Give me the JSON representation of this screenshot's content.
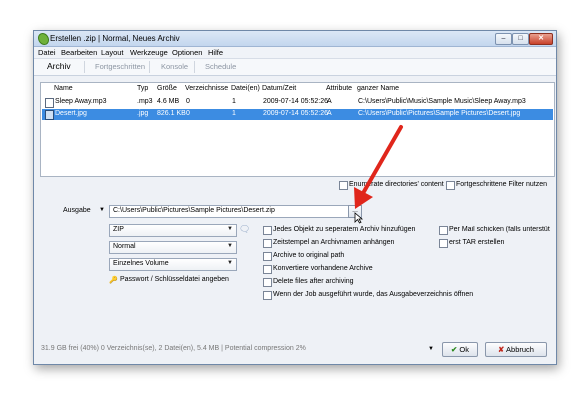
{
  "window": {
    "title": "Erstellen .zip | Normal, Neues Archiv",
    "controls": [
      "minimize",
      "maximize",
      "close"
    ]
  },
  "menu": [
    "Datei",
    "Bearbeiten",
    "Layout",
    "Werkzeuge",
    "Optionen",
    "Hilfe"
  ],
  "tabs": [
    "Archiv",
    "Fortgeschritten",
    "Konsole",
    "Schedule"
  ],
  "files": {
    "columns": [
      "Name",
      "Typ",
      "Größe",
      "Verzeichnisse",
      "Datei(en)",
      "Datum/Zeit",
      "Attribute",
      "ganzer Name"
    ],
    "rows": [
      [
        "Sleep Away.mp3",
        ".mp3",
        "4.6 MB",
        "0",
        "1",
        "2009-07-14 05:52:26",
        "A",
        "C:\\Users\\Public\\Music\\Sample Music\\Sleep Away.mp3"
      ],
      [
        "Desert.jpg",
        ".jpg",
        "826.1 KB",
        "0",
        "1",
        "2009-07-14 05:52:26",
        "A",
        "C:\\Users\\Public\\Pictures\\Sample Pictures\\Desert.jpg"
      ]
    ],
    "selected_row": 1
  },
  "filters": {
    "enumerate": "Enumerate directories' content",
    "advanced": "Fortgeschrittene Filter nutzen"
  },
  "output": {
    "label": "Ausgabe",
    "path": "C:\\Users\\Public\\Pictures\\Sample Pictures\\Desert.zip",
    "browse": "...",
    "format": "ZIP",
    "level": "Normal",
    "volume": "Einzelnes Volume",
    "password": "Passwort / Schlüsseldatei angeben"
  },
  "options": [
    "Jedes Objekt zu seperatem Archiv hinzufügen",
    "Zeitstempel an Archivnamen anhängen",
    "Archive to original path",
    "Konvertiere vorhandene Archive",
    "Delete files after archiving",
    "Wenn der Job ausgeführt wurde, das Ausgabeverzeichnis öffnen"
  ],
  "options_right": [
    "Per Mail schicken (falls unterstüt",
    "erst TAR erstellen"
  ],
  "status": "31.9 GB frei (40%)   0 Verzeichnis(se), 2 Datei(en), 5.4 MB | Potential compression 2%",
  "buttons": {
    "ok": "Ok",
    "cancel": "Abbruch"
  },
  "colors": {
    "selection": "#3c8ce2",
    "arrow": "#e0261b",
    "title_bar": "#c3d6ee"
  }
}
